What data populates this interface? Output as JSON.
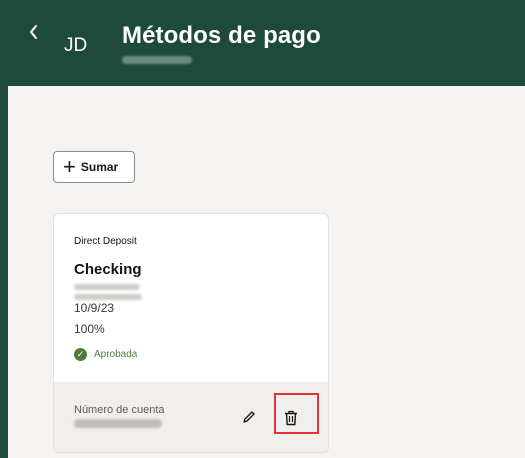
{
  "header": {
    "back_icon": "chevron-left-icon",
    "avatar_initials": "JD",
    "title": "Métodos de pago",
    "background": "#1e4a3b"
  },
  "toolbar": {
    "add_label": "Sumar",
    "add_icon": "plus-icon"
  },
  "card": {
    "type": "Direct Deposit",
    "name": "Checking",
    "date": "10/9/23",
    "percent": "100%",
    "status": "Aprobada",
    "status_color": "#4d7d3b",
    "account_label": "Número de cuenta",
    "edit_icon": "pencil-icon",
    "delete_icon": "trash-icon"
  },
  "highlight_color": "#e0333a"
}
